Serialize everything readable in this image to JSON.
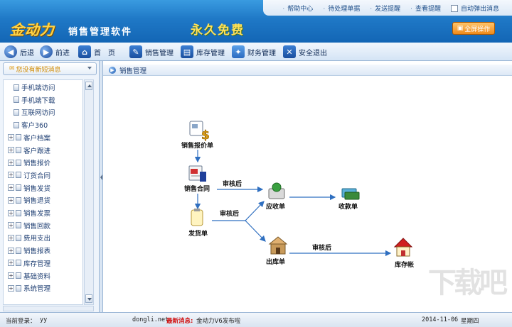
{
  "topbar": {
    "links": [
      "帮助中心",
      "待处理单据",
      "发送提醒",
      "查看提醒"
    ],
    "popup_label": "自动弹出消息"
  },
  "header": {
    "logo": "金动力",
    "title": "销售管理软件",
    "slogan": "永久免费",
    "fullscreen_label": "全屏操作"
  },
  "toolbar": {
    "back": "后退",
    "forward": "前进",
    "home": "首　页",
    "sales": "销售管理",
    "inventory": "库存管理",
    "finance": "财务管理",
    "logout": "安全退出"
  },
  "sidebar": {
    "notice": "您没有新短消息",
    "items": [
      {
        "label": "手机端访问",
        "expandable": false
      },
      {
        "label": "手机端下载",
        "expandable": false
      },
      {
        "label": "互联网访问",
        "expandable": false
      },
      {
        "label": "客户360",
        "expandable": false
      },
      {
        "label": "客户档案",
        "expandable": true
      },
      {
        "label": "客户跟进",
        "expandable": true
      },
      {
        "label": "销售报价",
        "expandable": true
      },
      {
        "label": "订货合同",
        "expandable": true
      },
      {
        "label": "销售发货",
        "expandable": true
      },
      {
        "label": "销售退货",
        "expandable": true
      },
      {
        "label": "销售发票",
        "expandable": true
      },
      {
        "label": "销售回款",
        "expandable": true
      },
      {
        "label": "费用支出",
        "expandable": true
      },
      {
        "label": "销售报表",
        "expandable": true
      },
      {
        "label": "库存管理",
        "expandable": true
      },
      {
        "label": "基础资料",
        "expandable": true
      },
      {
        "label": "系统管理",
        "expandable": true
      }
    ]
  },
  "panel": {
    "title": "销售管理"
  },
  "flow": {
    "nodes": {
      "quote": "销售报价单",
      "contract": "销售合同",
      "delivery": "发货单",
      "receivable": "应收单",
      "receipt": "收款单",
      "outbound": "出库单",
      "ledger": "库存帐"
    },
    "edge_labels": {
      "contract_receivable": "审核后",
      "delivery_split": "审核后",
      "outbound_ledger": "审核后"
    }
  },
  "watermark": "下载吧",
  "statusbar": {
    "login_label": "当前登录：",
    "user": "yy",
    "site": "dongli.net",
    "news_label": "最新消息:",
    "news": "金动力V6发布啦",
    "date": "2014-11-06",
    "weekday": "星期四"
  }
}
